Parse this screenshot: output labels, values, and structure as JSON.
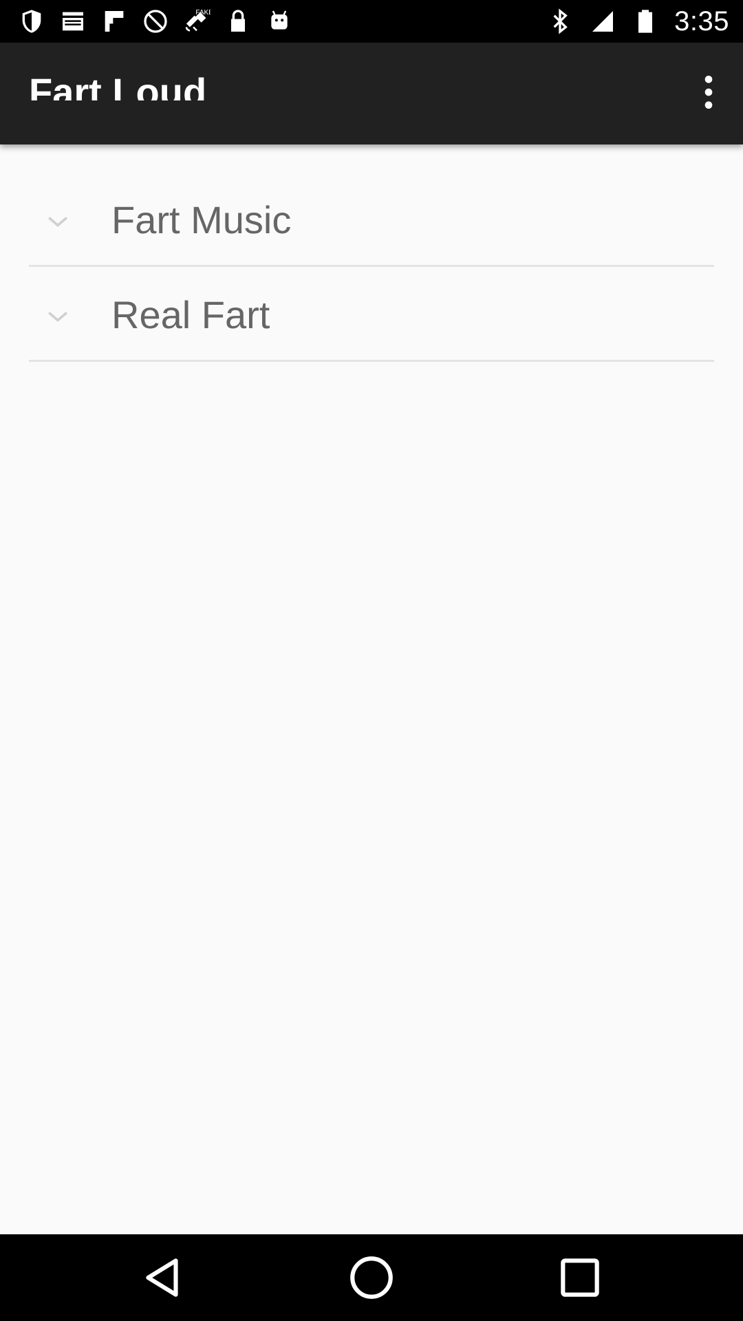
{
  "status_bar": {
    "time": "3:35",
    "left_icons": [
      "shield-icon",
      "mail-icon",
      "flipboard-icon",
      "do-not-disturb-icon",
      "fake-gps-icon",
      "lock-icon",
      "android-icon"
    ],
    "right_icons": [
      "bluetooth-icon",
      "signal-icon",
      "battery-icon"
    ]
  },
  "app_bar": {
    "title": "Fart Loud",
    "overflow_icon": "more-vert-icon",
    "background": "#212121"
  },
  "list": {
    "items": [
      {
        "label": "Fart Music",
        "icon": "chevron-down-icon"
      },
      {
        "label": "Real Fart",
        "icon": "chevron-down-icon"
      }
    ],
    "text_color": "#666666",
    "divider_color": "#e3e3e3"
  },
  "nav_bar": {
    "buttons": [
      "back-icon",
      "home-icon",
      "recents-icon"
    ]
  }
}
